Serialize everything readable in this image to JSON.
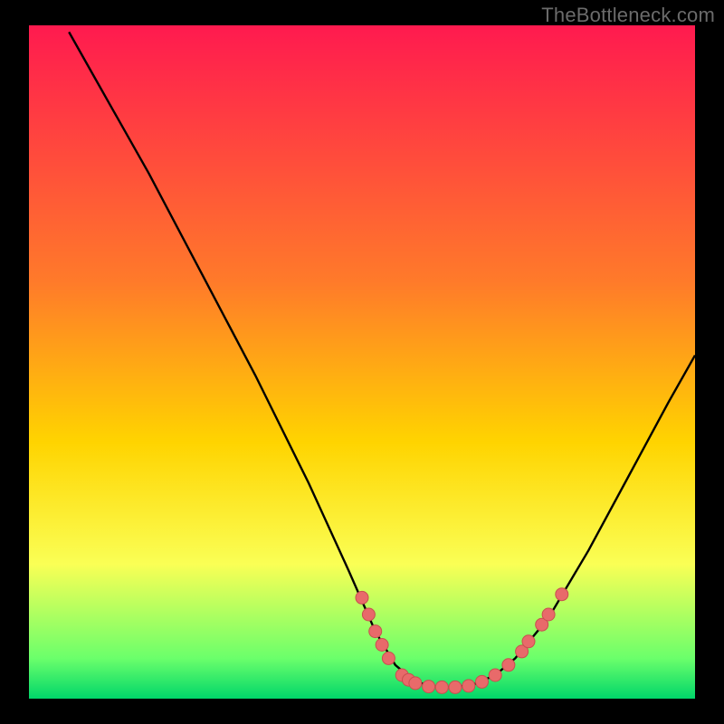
{
  "watermark": "TheBottleneck.com",
  "colors": {
    "bg": "#000000",
    "curve": "#000000",
    "marker_fill": "#e86a6a",
    "marker_stroke": "#c94f4f",
    "grad_top": "#ff1a4f",
    "grad_mid1": "#ff7a2a",
    "grad_mid2": "#ffd400",
    "grad_mid3": "#faff55",
    "grad_bottom1": "#6bff6b",
    "grad_bottom2": "#00d66a"
  },
  "chart_data": {
    "type": "line",
    "title": "",
    "xlabel": "",
    "ylabel": "",
    "xlim": [
      0,
      100
    ],
    "ylim": [
      0,
      100
    ],
    "curve": [
      {
        "x": 6,
        "y": 99
      },
      {
        "x": 10,
        "y": 92
      },
      {
        "x": 18,
        "y": 78
      },
      {
        "x": 26,
        "y": 63
      },
      {
        "x": 34,
        "y": 48
      },
      {
        "x": 42,
        "y": 32
      },
      {
        "x": 48,
        "y": 19
      },
      {
        "x": 52,
        "y": 10
      },
      {
        "x": 55,
        "y": 5
      },
      {
        "x": 58,
        "y": 2.5
      },
      {
        "x": 61,
        "y": 1.8
      },
      {
        "x": 64,
        "y": 1.7
      },
      {
        "x": 67,
        "y": 2.2
      },
      {
        "x": 70,
        "y": 3.5
      },
      {
        "x": 73,
        "y": 6
      },
      {
        "x": 78,
        "y": 12
      },
      {
        "x": 84,
        "y": 22
      },
      {
        "x": 90,
        "y": 33
      },
      {
        "x": 96,
        "y": 44
      },
      {
        "x": 100,
        "y": 51
      }
    ],
    "markers": [
      {
        "x": 50,
        "y": 15.0
      },
      {
        "x": 51,
        "y": 12.5
      },
      {
        "x": 52,
        "y": 10.0
      },
      {
        "x": 53,
        "y": 8.0
      },
      {
        "x": 54,
        "y": 6.0
      },
      {
        "x": 56,
        "y": 3.5
      },
      {
        "x": 57,
        "y": 2.8
      },
      {
        "x": 58,
        "y": 2.3
      },
      {
        "x": 60,
        "y": 1.8
      },
      {
        "x": 62,
        "y": 1.7
      },
      {
        "x": 64,
        "y": 1.7
      },
      {
        "x": 66,
        "y": 1.9
      },
      {
        "x": 68,
        "y": 2.5
      },
      {
        "x": 70,
        "y": 3.5
      },
      {
        "x": 72,
        "y": 5.0
      },
      {
        "x": 74,
        "y": 7.0
      },
      {
        "x": 75,
        "y": 8.5
      },
      {
        "x": 77,
        "y": 11.0
      },
      {
        "x": 78,
        "y": 12.5
      },
      {
        "x": 80,
        "y": 15.5
      }
    ]
  }
}
